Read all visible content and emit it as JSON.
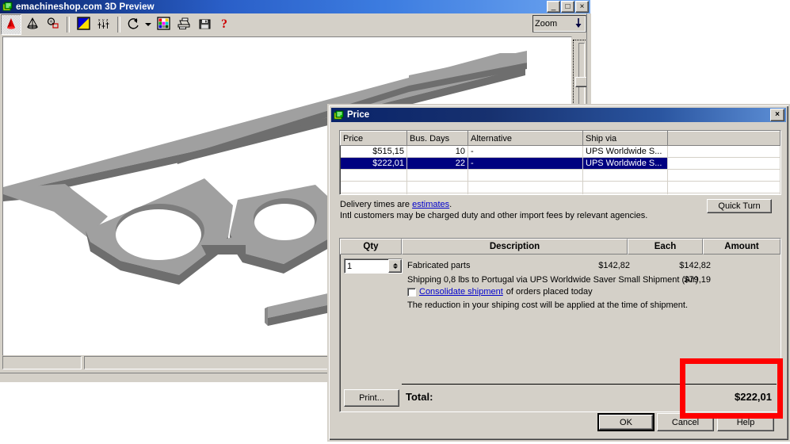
{
  "app_window": {
    "title": "emachineshop.com 3D Preview",
    "icon": "app-window-icon",
    "title_buttons": [
      {
        "name": "minimize-button",
        "glyph": "_"
      },
      {
        "name": "maximize-button",
        "glyph": "□"
      },
      {
        "name": "close-button",
        "glyph": "×"
      }
    ],
    "toolbar": [
      {
        "name": "solid-view-button",
        "icon": "red-cone-icon",
        "pressed": true
      },
      {
        "name": "wireframe-view-button",
        "icon": "wireframe-pyramid-icon",
        "pressed": false
      },
      {
        "name": "camera-view-button",
        "icon": "camera-icon",
        "pressed": false
      },
      {
        "name": "color-button",
        "icon": "blue-yellow-square-icon",
        "pressed": false
      },
      {
        "name": "axes-button",
        "icon": "xyz-axes-icon",
        "pressed": false
      },
      {
        "name": "rotate-button",
        "icon": "rotate-arrow-icon",
        "pressed": false
      },
      {
        "name": "palette-button",
        "icon": "color-grid-icon",
        "pressed": false
      },
      {
        "name": "print-button",
        "icon": "printer-icon",
        "pressed": false
      },
      {
        "name": "save-button",
        "icon": "floppy-disk-icon",
        "pressed": false
      },
      {
        "name": "help-button",
        "icon": "question-mark-icon",
        "pressed": false
      }
    ],
    "zoom_control": {
      "label": "Zoom",
      "icon": "down-arrow-icon"
    },
    "status_bar": {
      "pane1": "",
      "pane2": ""
    }
  },
  "price_dialog": {
    "title": "Price",
    "icon": "price-window-icon",
    "close_label": "×",
    "grid": {
      "headers": [
        "Price",
        "Bus. Days",
        "Alternative",
        "Ship via",
        ""
      ],
      "rows": [
        {
          "price": "$515,15",
          "days": "10",
          "alternative": "-",
          "ship_via": "UPS Worldwide S...",
          "blank": "",
          "selected": false
        },
        {
          "price": "$222,01",
          "days": "22",
          "alternative": "-",
          "ship_via": "UPS Worldwide S...",
          "blank": "",
          "selected": true
        }
      ],
      "empty_rows": 3
    },
    "delivery_note_line1_pre": "Delivery times are ",
    "delivery_note_link": "estimates",
    "delivery_note_line1_post": ".",
    "delivery_note_line2": "Intl customers may be charged duty and other import fees by relevant agencies.",
    "quick_turn_label": "Quick Turn",
    "order": {
      "headers": {
        "qty": "Qty",
        "description": "Description",
        "each": "Each",
        "amount": "Amount"
      },
      "qty_value": "1",
      "line1": {
        "description": "Fabricated parts",
        "each": "$142,82",
        "amount": "$142,82"
      },
      "line2": {
        "description": "Shipping 0,8 lbs to Portugal via UPS Worldwide Saver Small Shipment (Air)",
        "amount": "$79,19"
      },
      "consolidate_link": "Consolidate shipment",
      "consolidate_suffix": " of orders placed today",
      "line3": "The reduction in your shiping cost will be applied at the time of shipment.",
      "print_label": "Print...",
      "total_label": "Total:",
      "total_value": "$222,01"
    },
    "buttons": {
      "ok": "OK",
      "cancel": "Cancel",
      "help": "Help"
    }
  },
  "annotation": {
    "highlight_color": "#ff0000"
  },
  "colors": {
    "face_color": "#a0a0a0",
    "dark_face_color": "#737373",
    "mid_face_color": "#8f8f8f",
    "selection_blue": "#000080",
    "dialog_face": "#d4d0c8"
  }
}
